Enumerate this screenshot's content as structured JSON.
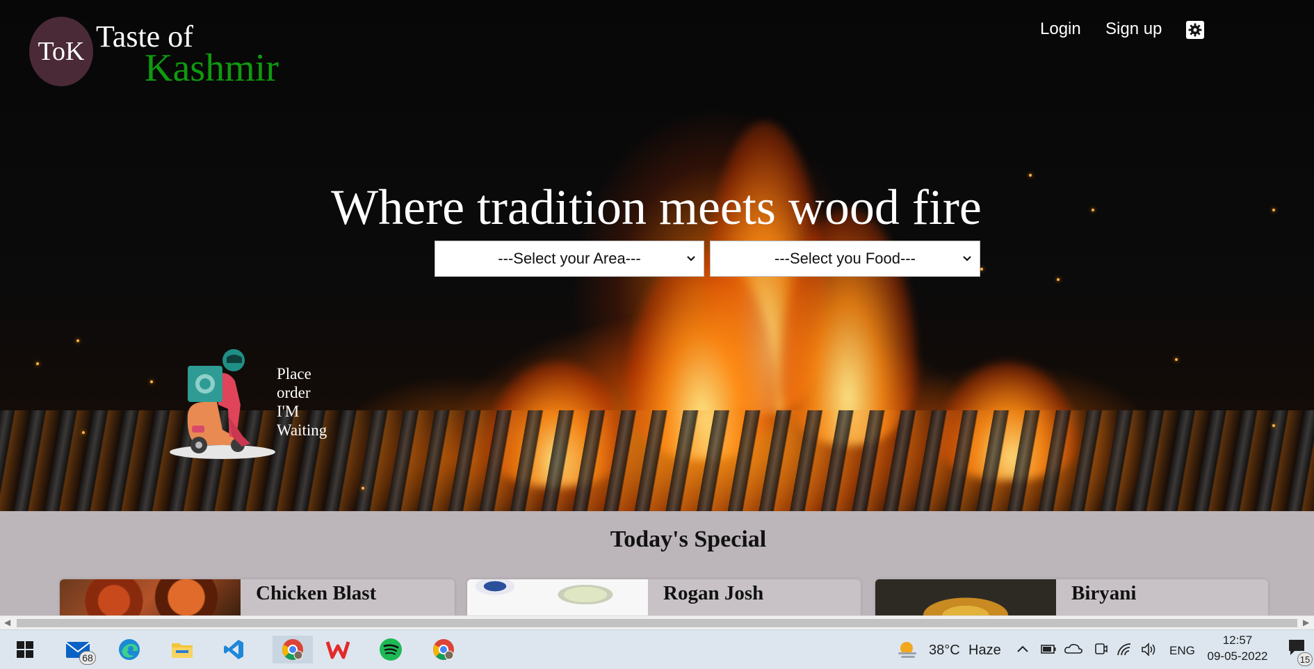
{
  "logo": {
    "initials": "ToK",
    "line1": "Taste of",
    "line2": "Kashmir"
  },
  "nav": {
    "login": "Login",
    "signup": "Sign up"
  },
  "hero": {
    "headline": "Where tradition meets wood fire",
    "area_select": "---Select your Area---",
    "food_select": "---Select you Food---"
  },
  "delivery": {
    "lines": [
      "Place",
      "order",
      "I'M",
      "Waiting"
    ]
  },
  "special": {
    "title": "Today's Special",
    "cards": [
      {
        "name": "Chicken Blast"
      },
      {
        "name": "Rogan Josh"
      },
      {
        "name": "Biryani"
      }
    ]
  },
  "taskbar": {
    "mail_badge": "68",
    "weather": {
      "temp": "38°C",
      "condition": "Haze"
    },
    "language": "ENG",
    "time": "12:57",
    "date": "09-05-2022",
    "notification_count": "15"
  },
  "colors": {
    "brand_green": "#0f9a0f",
    "logo_bg": "#4a2a36",
    "section_bg": "#bcb5ba"
  }
}
